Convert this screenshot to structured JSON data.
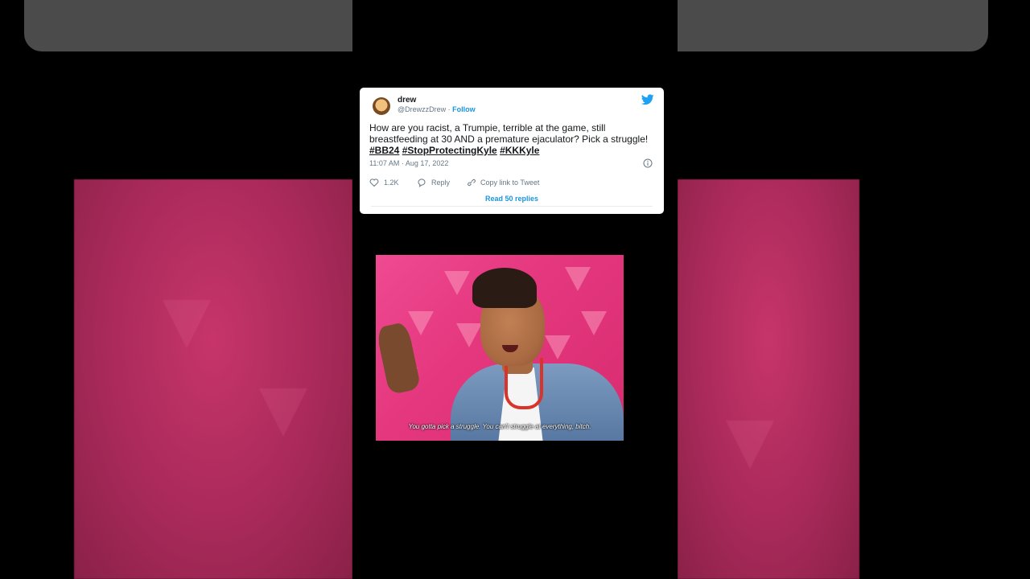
{
  "tweet": {
    "author_name": "drew",
    "author_handle": "@DrewzzDrew",
    "separator": "·",
    "follow_label": "Follow",
    "text_plain": "How are you racist, a Trumpie, terrible at the game, still breastfeeding at 30 AND a premature ejaculator? Pick a struggle!",
    "hashtags": [
      "#BB24",
      "#StopProtectingKyle",
      "#KKKyle"
    ],
    "timestamp": "11:07 AM · Aug 17, 2022",
    "likes": "1.2K",
    "reply_label": "Reply",
    "copy_link_label": "Copy link to Tweet",
    "read_replies_label": "Read 50 replies",
    "icons": {
      "brand": "twitter-bird-icon",
      "info": "info-icon",
      "like": "heart-icon",
      "reply": "reply-bubble-icon",
      "copy": "link-icon"
    },
    "colors": {
      "link": "#1b95e0",
      "brand": "#1da1f2",
      "text": "#14171a",
      "muted": "#657786"
    }
  },
  "gif": {
    "subtitle": "You gotta pick a struggle. You can't struggle at everything, bitch.",
    "background_color": "#e5387f"
  }
}
